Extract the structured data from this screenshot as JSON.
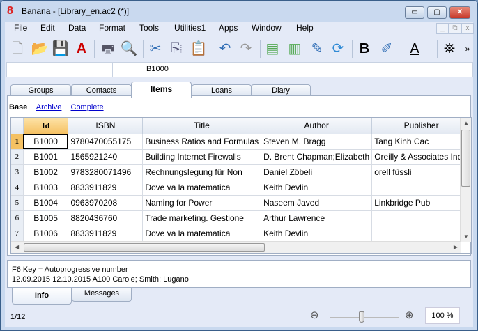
{
  "window": {
    "title": "Banana - [Library_en.ac2 (*)]",
    "minimize": "▭",
    "maximize": "▢",
    "close": "✕"
  },
  "menu": [
    "File",
    "Edit",
    "Data",
    "Format",
    "Tools",
    "Utilities1",
    "Apps",
    "Window",
    "Help"
  ],
  "mdi": {
    "minimize": "_",
    "restore": "⧉",
    "close": "x"
  },
  "toolbar": {
    "bold": "B",
    "font_color": "A",
    "more": "»"
  },
  "cellbar": {
    "address": "",
    "value": "B1000"
  },
  "tabs": [
    "Groups",
    "Contacts",
    "Items",
    "Loans",
    "Diary"
  ],
  "active_tab": "Items",
  "views": {
    "base": "Base",
    "archive": "Archive",
    "complete": "Complete"
  },
  "table": {
    "columns": [
      "Id",
      "ISBN",
      "Title",
      "Author",
      "Publisher"
    ],
    "rows": [
      {
        "n": "1",
        "id": "B1000",
        "isbn": "9780470055175",
        "title": "Business Ratios and Formulas",
        "author": "Steven M. Bragg",
        "publisher": "Tang Kinh Cac"
      },
      {
        "n": "2",
        "id": "B1001",
        "isbn": "1565921240",
        "title": "Building Internet Firewalls",
        "author": "D. Brent Chapman;Elizabeth",
        "publisher": "Oreilly & Associates Inc"
      },
      {
        "n": "3",
        "id": "B1002",
        "isbn": "9783280071496",
        "title": "Rechnungslegung für Non",
        "author": "Daniel Zöbeli",
        "publisher": "orell füssli"
      },
      {
        "n": "4",
        "id": "B1003",
        "isbn": "8833911829",
        "title": "Dove va la matematica",
        "author": "Keith Devlin",
        "publisher": ""
      },
      {
        "n": "5",
        "id": "B1004",
        "isbn": "0963970208",
        "title": "Naming for Power",
        "author": "Naseem Javed",
        "publisher": "Linkbridge Pub"
      },
      {
        "n": "6",
        "id": "B1005",
        "isbn": "8820436760",
        "title": "Trade marketing. Gestione",
        "author": "Arthur Lawrence",
        "publisher": ""
      },
      {
        "n": "7",
        "id": "B1006",
        "isbn": "8833911829",
        "title": "Dove va la matematica",
        "author": "Keith Devlin",
        "publisher": ""
      }
    ]
  },
  "info": {
    "line1": "F6 Key = Autoprogressive number",
    "line2": "12.09.2015 12.10.2015 A100 Carole; Smith; Lugano"
  },
  "bottom_tabs": [
    "Info",
    "Messages"
  ],
  "status": {
    "position": "1/12",
    "zoom": "100 %"
  }
}
